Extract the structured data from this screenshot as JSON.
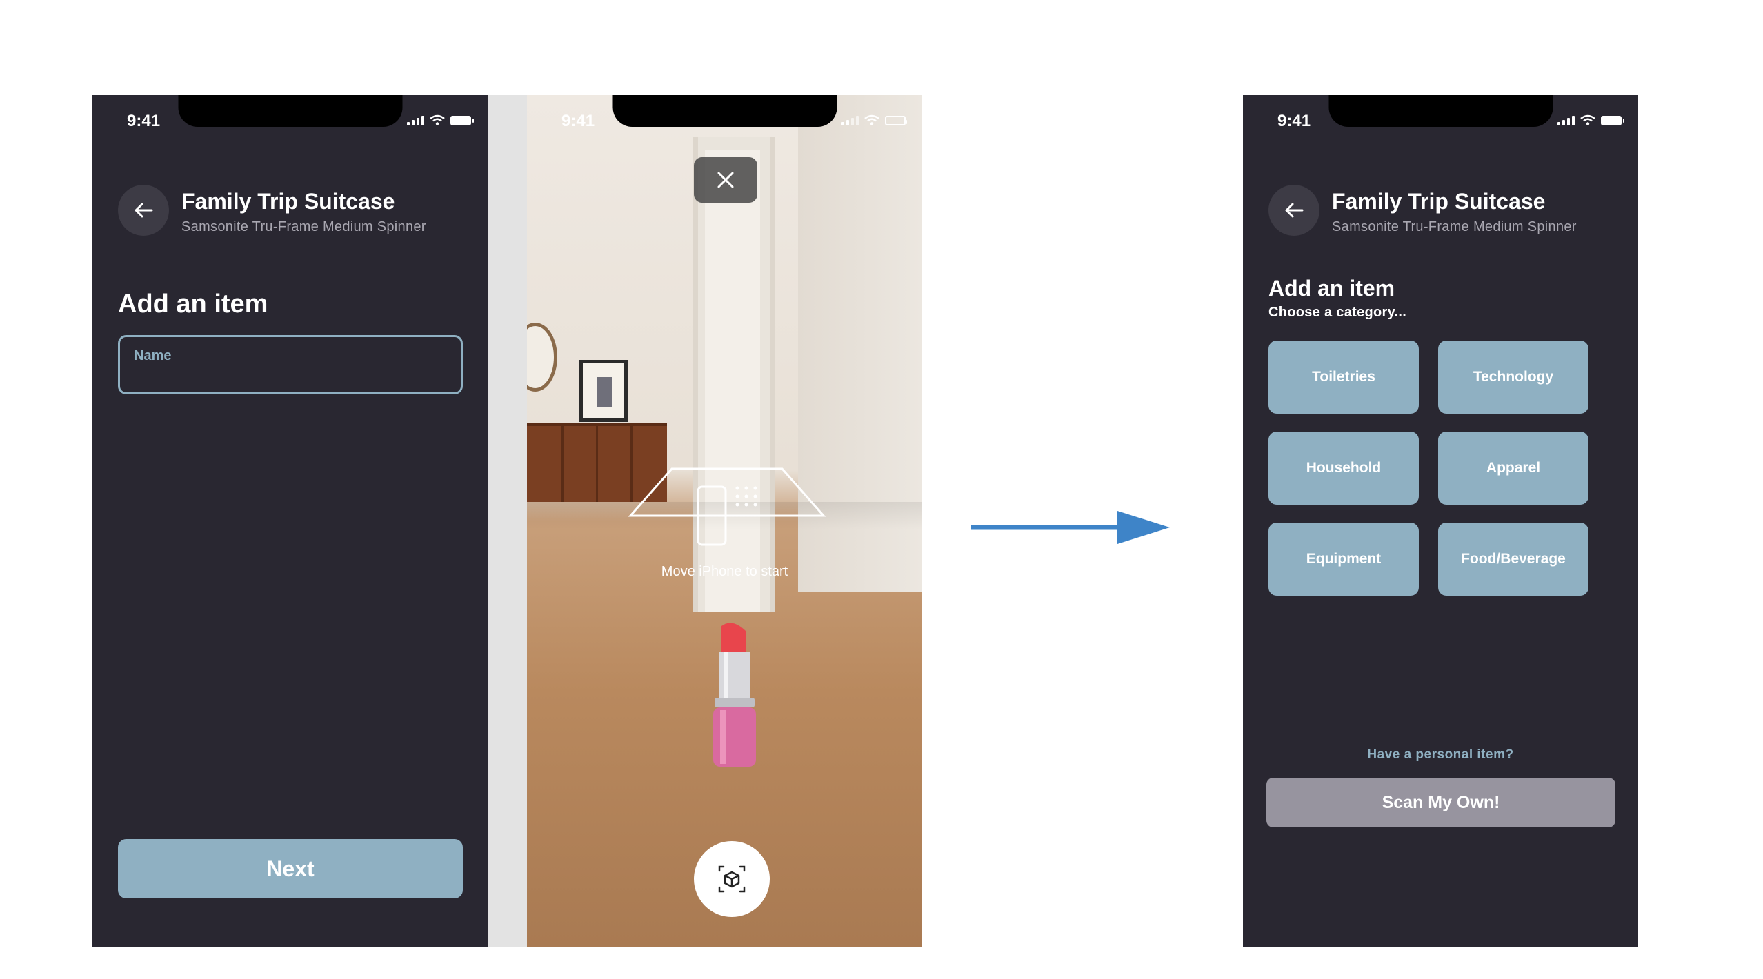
{
  "status_bar": {
    "time": "9:41"
  },
  "screen_name": {
    "header": {
      "title": "Family Trip Suitcase",
      "subtitle": "Samsonite Tru-Frame Medium Spinner"
    },
    "heading": "Add an item",
    "name_field": {
      "label": "Name",
      "value": ""
    },
    "next_label": "Next"
  },
  "screen_ar": {
    "hint": "Move iPhone to start",
    "icons": {
      "close": "close-icon",
      "ar_capture": "ar-cube-icon",
      "object": "lipstick-model"
    }
  },
  "screen_category": {
    "header": {
      "title": "Family Trip Suitcase",
      "subtitle": "Samsonite Tru-Frame Medium Spinner"
    },
    "heading": "Add an item",
    "subheading": "Choose a category...",
    "categories": [
      "Toiletries",
      "Technology",
      "Household",
      "Apparel",
      "Equipment",
      "Food/Beverage"
    ],
    "personal_prompt": "Have a personal item?",
    "scan_label": "Scan My Own!"
  },
  "colors": {
    "background_dark": "#292731",
    "accent_blue": "#8fb0c2",
    "scan_button": "#97949f",
    "flow_arrow": "#3e84c8"
  }
}
